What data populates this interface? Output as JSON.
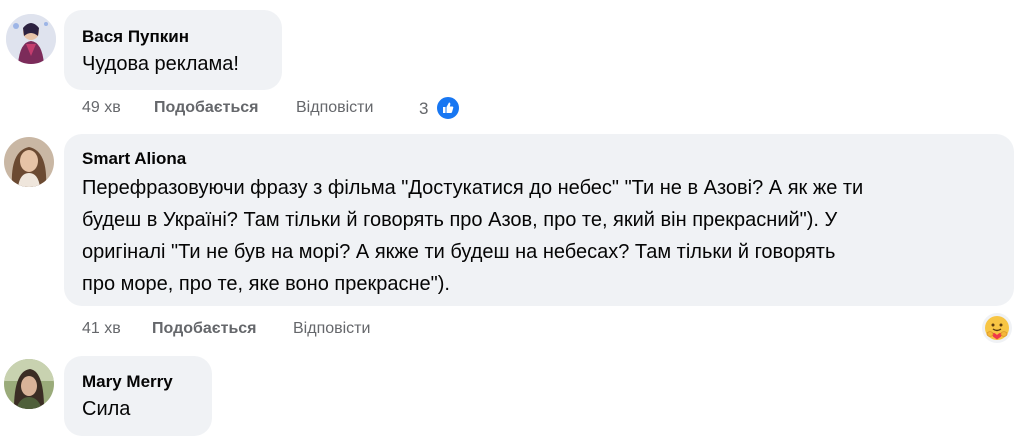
{
  "comments": [
    {
      "author": "Вася Пупкин",
      "text": "Чудова реклама!",
      "time": "49 хв",
      "like_label": "Подобається",
      "reply_label": "Відповісти",
      "reactions_count": "3",
      "reaction_icon": "like-icon"
    },
    {
      "author": "Smart Aliona",
      "text_lines": [
        "Перефразовуючи фразу з фільма \"Достукатися до небес\" \"Ти не в Азові? А як же ти",
        "будеш в Україні? Там тільки й говорять про Азов, про те, який він прекрасний\"). У",
        "оригіналі \"Ти не був на морі? А якже ти будеш на небесах? Там тільки й говорять",
        "про море, про те, яке воно прекрасне\")."
      ],
      "time": "41 хв",
      "like_label": "Подобається",
      "reply_label": "Відповісти",
      "reaction_icon": "care-icon"
    },
    {
      "author": "Mary Merry",
      "text": "Сила"
    }
  ]
}
